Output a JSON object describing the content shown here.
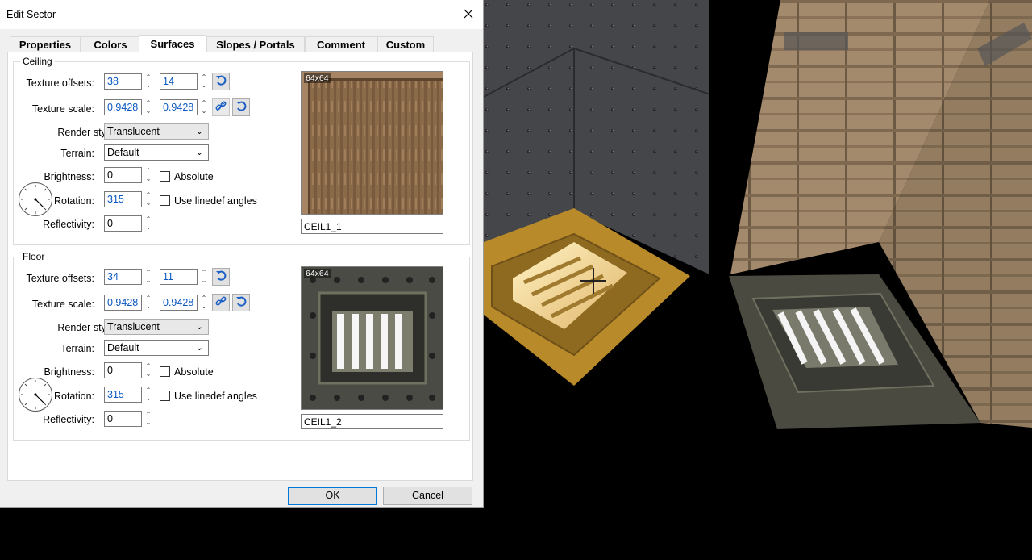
{
  "window": {
    "title": "Edit Sector"
  },
  "tabs": [
    {
      "label": "Properties"
    },
    {
      "label": "Colors"
    },
    {
      "label": "Surfaces"
    },
    {
      "label": "Slopes / Portals"
    },
    {
      "label": "Comment"
    },
    {
      "label": "Custom"
    }
  ],
  "active_tab": "Surfaces",
  "labels": {
    "texture_offsets": "Texture offsets:",
    "texture_scale": "Texture scale:",
    "render_style": "Render style:",
    "terrain": "Terrain:",
    "brightness": "Brightness:",
    "rotation": "Rotation:",
    "reflectivity": "Reflectivity:",
    "absolute": "Absolute",
    "use_linedef_angles": "Use linedef angles"
  },
  "ceiling": {
    "title": "Ceiling",
    "offset_x": "38",
    "offset_y": "14",
    "scale_x": "0.9428",
    "scale_y": "0.9428",
    "render_style": "Translucent",
    "terrain": "Default",
    "brightness": "0",
    "absolute_checked": false,
    "rotation": "315",
    "rotation_degrees": 315,
    "use_linedef_angles_checked": false,
    "reflectivity": "0",
    "texture_size": "64x64",
    "texture_name": "CEIL1_1"
  },
  "floor": {
    "title": "Floor",
    "offset_x": "34",
    "offset_y": "11",
    "scale_x": "0.9428",
    "scale_y": "0.9428",
    "render_style": "Translucent",
    "terrain": "Default",
    "brightness": "0",
    "absolute_checked": false,
    "rotation": "315",
    "rotation_degrees": 315,
    "use_linedef_angles_checked": false,
    "reflectivity": "0",
    "texture_size": "64x64",
    "texture_name": "CEIL1_2"
  },
  "buttons": {
    "ok": "OK",
    "cancel": "Cancel"
  },
  "icons": {
    "close": "close-icon",
    "reset": "undo-arrow-icon",
    "link": "chain-link-icon",
    "spin": "spin-arrows-icon"
  },
  "colors": {
    "accent": "#0078d7",
    "value_text": "#0a58c0",
    "dialog_bg": "#f0f0f0"
  }
}
